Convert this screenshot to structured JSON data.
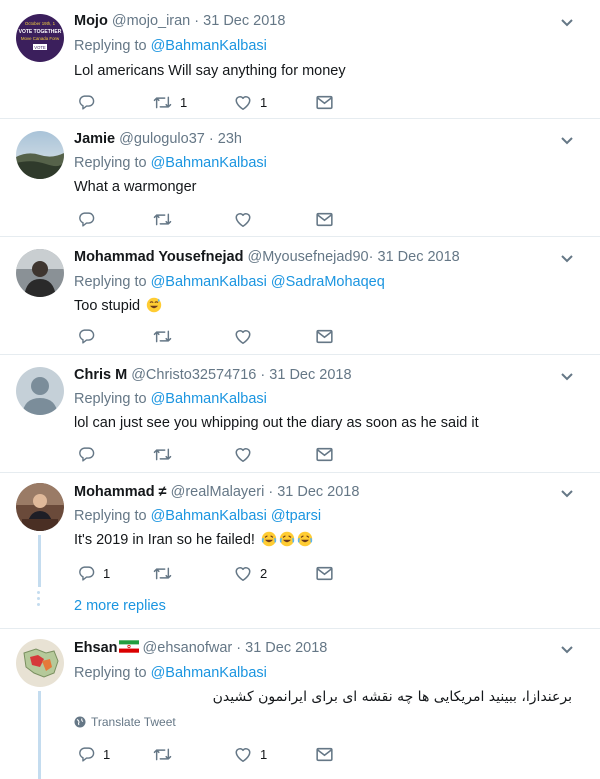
{
  "tweets": [
    {
      "name": "Mojo",
      "handle": "@mojo_iran",
      "time": "31 Dec 2018",
      "replying_label": "Replying to",
      "mentions": [
        "@BahmanKalbasi"
      ],
      "text": "Lol americans Will say anything for money",
      "reply_count": "",
      "retweet_count": "1",
      "like_count": "1"
    },
    {
      "name": "Jamie",
      "handle": "@gulogulo37",
      "time": "23h",
      "replying_label": "Replying to",
      "mentions": [
        "@BahmanKalbasi"
      ],
      "text": "What a warmonger",
      "reply_count": "",
      "retweet_count": "",
      "like_count": ""
    },
    {
      "name": "Mohammad Yousefnejad",
      "handle": "@Myousefnejad90",
      "time": "31 Dec 2018",
      "replying_label": "Replying to",
      "mentions": [
        "@BahmanKalbasi",
        "@SadraMohaqeq"
      ],
      "text": "Too stupid",
      "reply_count": "",
      "retweet_count": "",
      "like_count": ""
    },
    {
      "name": "Chris M",
      "handle": "@Christo32574716",
      "time": "31 Dec 2018",
      "replying_label": "Replying to",
      "mentions": [
        "@BahmanKalbasi"
      ],
      "text": "lol can just see you whipping out the diary as soon as he said it",
      "reply_count": "",
      "retweet_count": "",
      "like_count": ""
    },
    {
      "name": "Mohammad ≠",
      "handle": "@realMalayeri",
      "time": "31 Dec 2018",
      "replying_label": "Replying to",
      "mentions": [
        "@BahmanKalbasi",
        "@tparsi"
      ],
      "text": "It's 2019 in Iran so he failed!",
      "reply_count": "1",
      "retweet_count": "",
      "like_count": "2"
    },
    {
      "name": "Ehsan",
      "handle": "@ehsanofwar",
      "time": "31 Dec 2018",
      "replying_label": "Replying to",
      "mentions": [
        "@BahmanKalbasi"
      ],
      "text": "برعندازا، ببینید امریکایی ها چه نقشه ای برای ایرانمون کشیدن",
      "reply_count": "1",
      "retweet_count": "",
      "like_count": "1"
    }
  ],
  "separator": "·",
  "more_replies": "2 more replies",
  "translate_label": "Translate Tweet",
  "avatar0_lines": [
    "October 19th, 1",
    "VOTE TOGETHER",
    "Move Canada Forw",
    "VOTE"
  ],
  "colors": {
    "link": "#1b95e0",
    "muted": "#657786",
    "thread": "#c4dcef"
  },
  "icons": [
    "reply-icon",
    "retweet-icon",
    "like-icon",
    "message-icon",
    "chevron-down-icon",
    "globe-icon"
  ]
}
